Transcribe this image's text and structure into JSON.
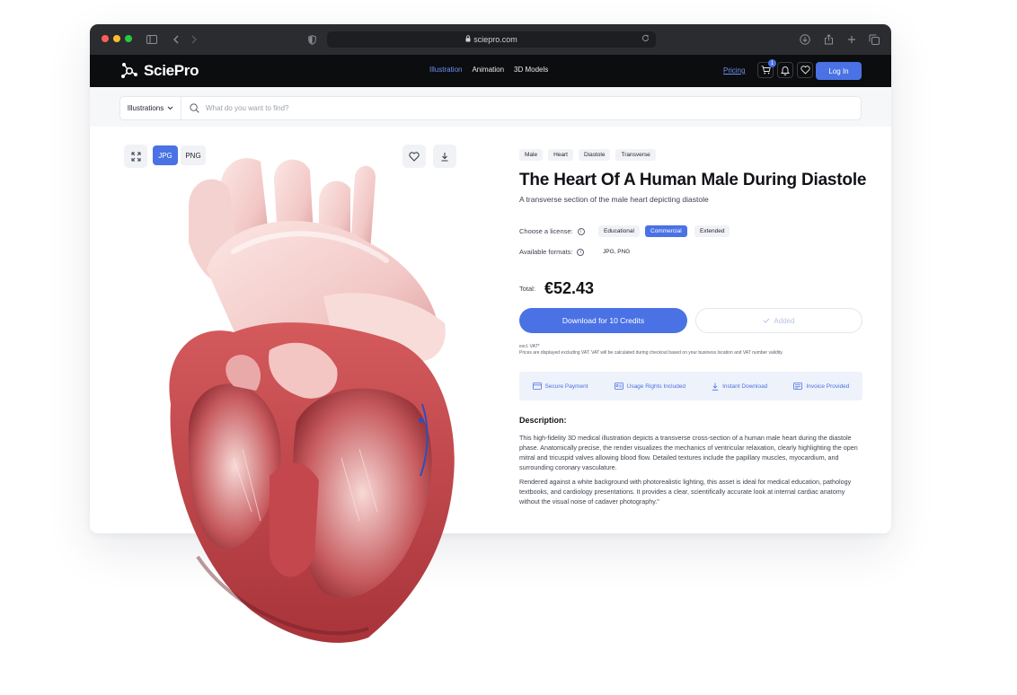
{
  "browser": {
    "url": "sciepro.com"
  },
  "navbar": {
    "logo": "SciePro",
    "links": [
      {
        "label": "Illustration",
        "active": true
      },
      {
        "label": "Animation",
        "active": false
      },
      {
        "label": "3D Models",
        "active": false
      }
    ],
    "pricing": "Pricing",
    "cart_badge": "1",
    "login": "Log In"
  },
  "search": {
    "category": "Illustrations",
    "placeholder": "What do you want to find?"
  },
  "viewer": {
    "formats": [
      {
        "label": "JPG",
        "selected": true
      },
      {
        "label": "PNG",
        "selected": false
      }
    ]
  },
  "product": {
    "tags": [
      "Male",
      "Heart",
      "Diastole",
      "Transverse"
    ],
    "title": "The Heart Of A Human Male During Diastole",
    "subtitle": "A transverse section of the male heart depicting diastole",
    "license_label": "Choose a license:",
    "licenses": [
      {
        "label": "Educational",
        "selected": false
      },
      {
        "label": "Commercial",
        "selected": true
      },
      {
        "label": "Extended",
        "selected": false
      }
    ],
    "formats_label": "Available formats:",
    "formats_value": "JPG, PNG",
    "total_label": "Total:",
    "total_price": "€52.43",
    "download_button": "Download for 10 Credits",
    "added_button": "Added",
    "vat_line1": "excl. VAT*",
    "vat_line2": "Prices are displayed excluding VAT. VAT will be calculated during checkout based on your business location and VAT number validity.",
    "features": [
      "Secure Payment",
      "Usage Rights Included",
      "Instant Download",
      "Invoice Provided"
    ],
    "description_heading": "Description:",
    "description_p1": "This high-fidelity 3D medical illustration depicts a transverse cross-section of a human male heart during the diastole phase. Anatomically precise, the render visualizes the mechanics of ventricular relaxation, clearly highlighting the open mitral and tricuspid valves allowing blood flow. Detailed textures include the papillary muscles, myocardium, and surrounding coronary vasculature.",
    "description_p2": "Rendered against a white background with photorealistic lighting, this asset is ideal for medical education, pathology textbooks, and cardiology presentations. It provides a clear, scientifically accurate look at internal cardiac anatomy without the visual noise of cadaver photography.\""
  },
  "colors": {
    "accent": "#4a72e5",
    "nav_bg": "#0c0d0f",
    "chrome_bg": "#2b2c30",
    "feature_bg": "#eef2fb"
  }
}
